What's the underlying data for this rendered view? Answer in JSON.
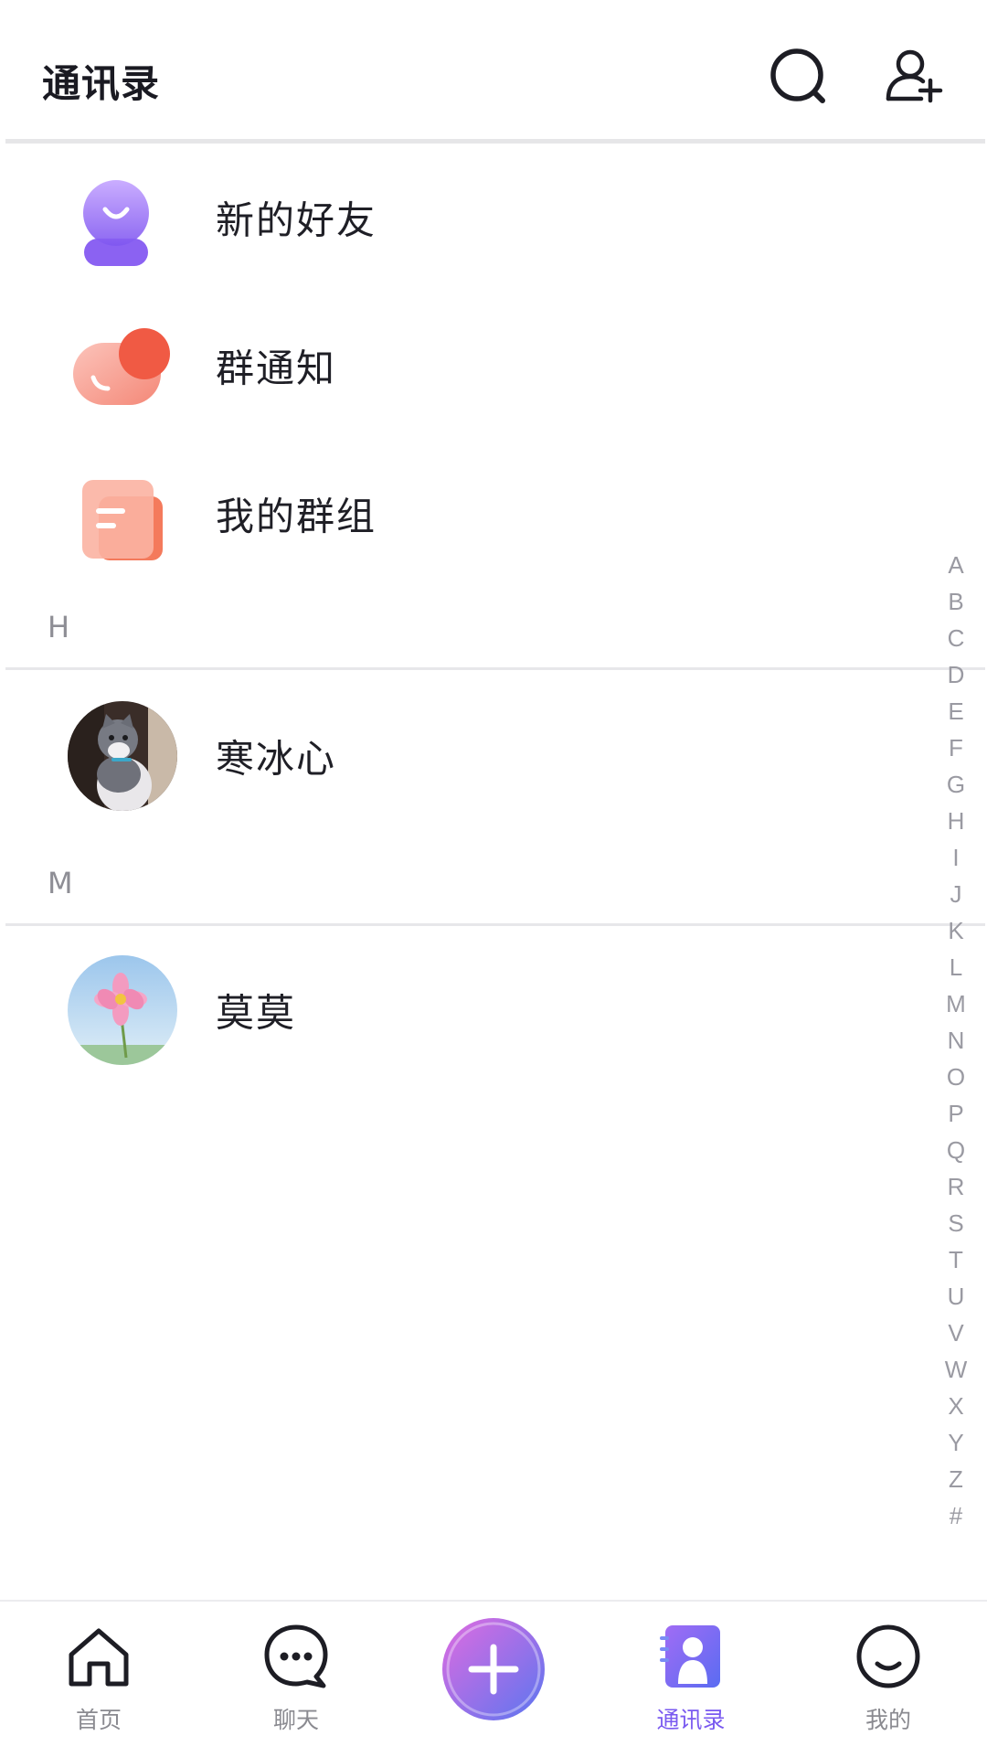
{
  "header": {
    "title": "通讯录",
    "search_icon": "search-icon",
    "add_friend_icon": "add-friend-icon"
  },
  "shortcuts": [
    {
      "label": "新的好友",
      "icon": "new-friends-icon",
      "color": "#9b6cf0"
    },
    {
      "label": "群通知",
      "icon": "group-notice-icon",
      "color": "#f0604a"
    },
    {
      "label": "我的群组",
      "icon": "my-groups-icon",
      "color": "#f5896f"
    }
  ],
  "sections": [
    {
      "letter": "H",
      "contacts": [
        {
          "name": "寒冰心",
          "avatar": "cat-avatar"
        }
      ]
    },
    {
      "letter": "M",
      "contacts": [
        {
          "name": "莫莫",
          "avatar": "flower-avatar"
        }
      ]
    }
  ],
  "alphabet_index": [
    "A",
    "B",
    "C",
    "D",
    "E",
    "F",
    "G",
    "H",
    "I",
    "J",
    "K",
    "L",
    "M",
    "N",
    "O",
    "P",
    "Q",
    "R",
    "S",
    "T",
    "U",
    "V",
    "W",
    "X",
    "Y",
    "Z",
    "#"
  ],
  "tabbar": {
    "tabs": [
      {
        "label": "首页",
        "icon": "home-icon"
      },
      {
        "label": "聊天",
        "icon": "chat-icon"
      },
      {
        "label": "",
        "icon": "plus-icon"
      },
      {
        "label": "通讯录",
        "icon": "contacts-icon",
        "active": true
      },
      {
        "label": "我的",
        "icon": "profile-icon"
      }
    ],
    "active_color": "#7a5af0",
    "inactive_color": "#8a8a90"
  }
}
